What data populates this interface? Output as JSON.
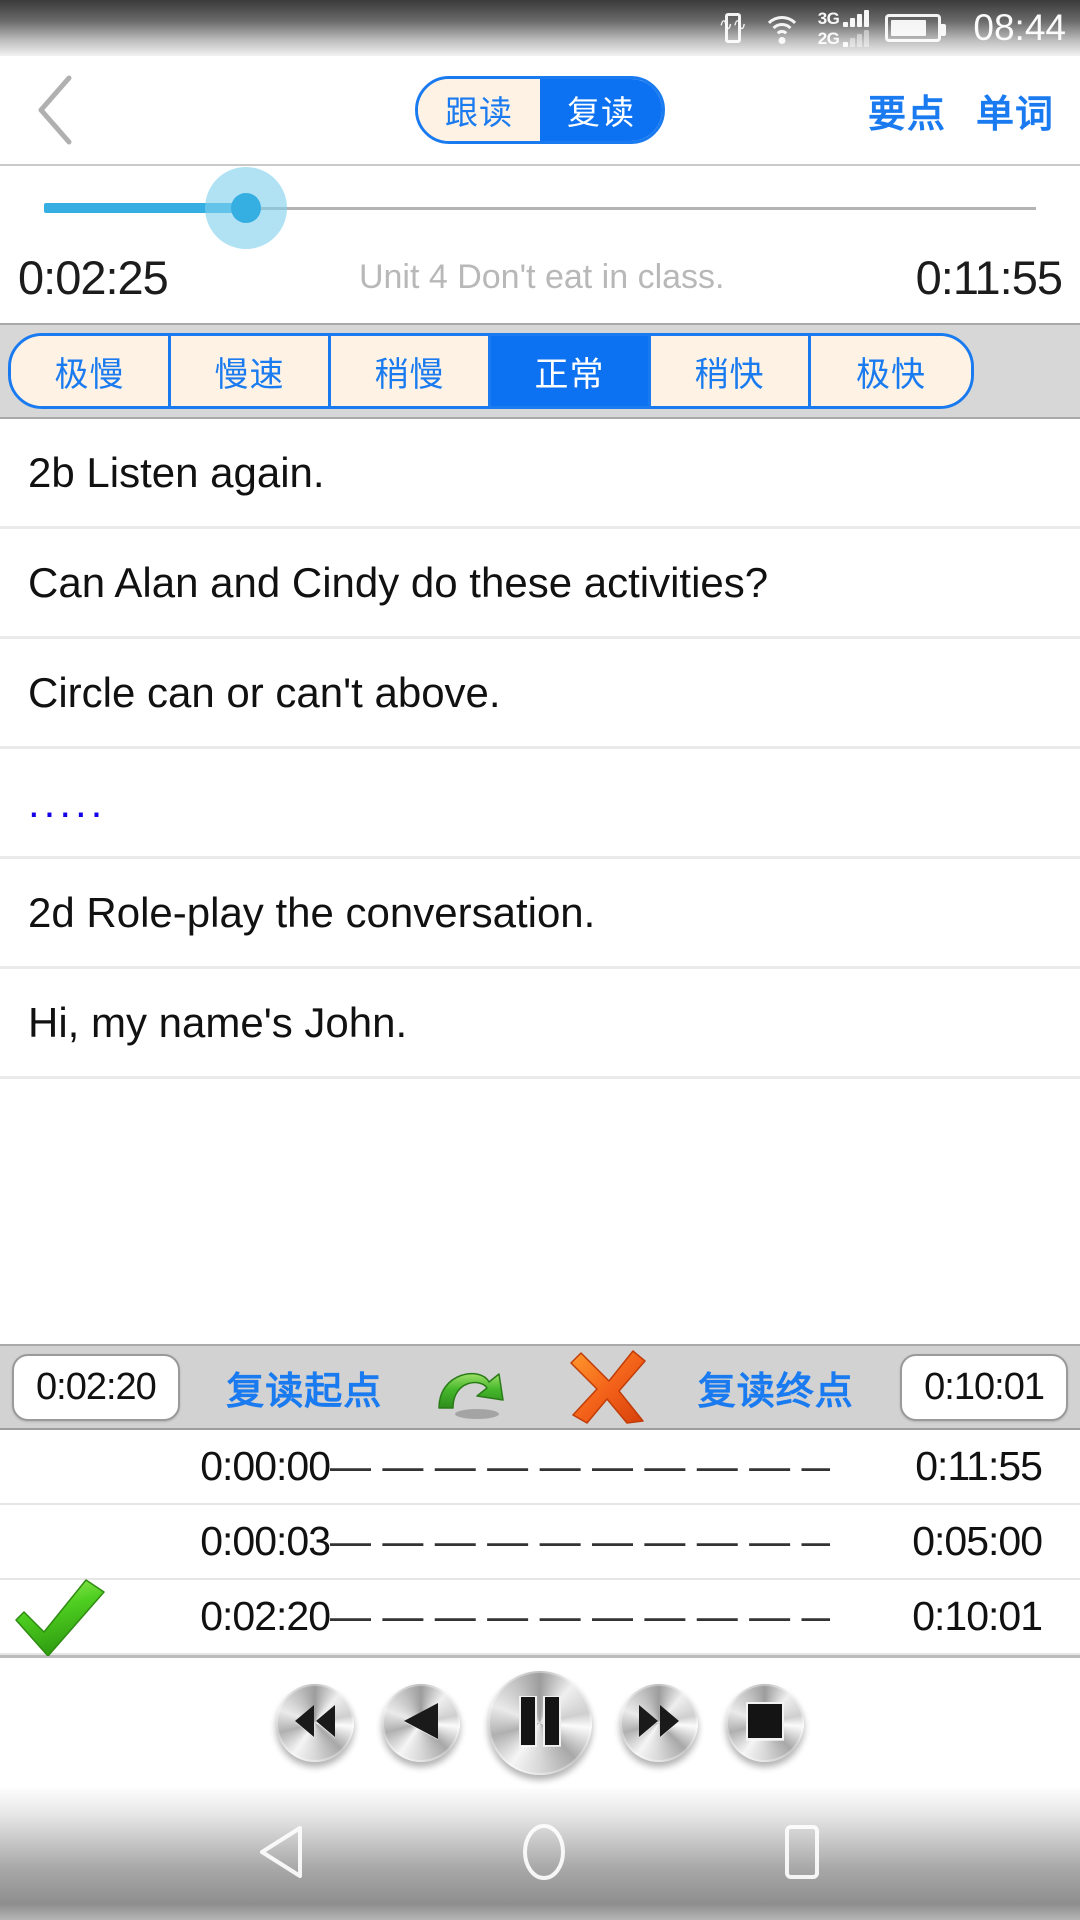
{
  "statusbar": {
    "time": "08:44",
    "icons": [
      "vibrate-icon",
      "wifi-icon",
      "signal-3g-icon",
      "signal-2g-icon",
      "battery-icon"
    ],
    "network_labels": [
      "3G",
      "2G"
    ],
    "battery_level_percent": 70
  },
  "navbar": {
    "back_icon": "chevron-left-icon",
    "segments": [
      {
        "label": "跟读",
        "active": false
      },
      {
        "label": "复读",
        "active": true
      }
    ],
    "links": [
      {
        "label": "要点"
      },
      {
        "label": "单词"
      }
    ],
    "accent_color": "#1a7bf0",
    "active_bg": "#0d72f2",
    "inactive_bg": "#fdf2e3"
  },
  "player_progress": {
    "current_time": "0:02:25",
    "total_time": "0:11:55",
    "track_title": "Unit 4 Don't eat in class.",
    "progress_percent": 20.4,
    "fill_color": "#35aee2",
    "halo_color": "#7fd0ee",
    "rail_color": "#b3b3b3"
  },
  "speed_selector": {
    "options": [
      {
        "label": "极慢",
        "active": false
      },
      {
        "label": "慢速",
        "active": false
      },
      {
        "label": "稍慢",
        "active": false
      },
      {
        "label": "正常",
        "active": true
      },
      {
        "label": "稍快",
        "active": false
      },
      {
        "label": "极快",
        "active": false
      }
    ],
    "bar_bg": "#d7d7d7"
  },
  "transcript": {
    "lines": [
      {
        "text": "2b Listen again.",
        "style": "normal"
      },
      {
        "text": "Can Alan and Cindy do these activities?",
        "style": "normal"
      },
      {
        "text": "Circle can or can't above.",
        "style": "normal"
      },
      {
        "text": ".....",
        "style": "dots"
      },
      {
        "text": "2d Role-play the conversation.",
        "style": "normal"
      },
      {
        "text": "Hi, my name's John.",
        "style": "normal"
      }
    ]
  },
  "repeat_bar": {
    "start_time": "0:02:20",
    "start_label": "复读起点",
    "loop_icon": "green-loop-arrow-icon",
    "cancel_icon": "orange-x-icon",
    "end_label": "复读终点",
    "end_time": "0:10:01",
    "bar_bg": "#d2d2d2"
  },
  "segment_list": {
    "dash_separator": "— — — — — — — — — — — —",
    "rows": [
      {
        "checked": false,
        "start": "0:00:00",
        "end": "0:11:55"
      },
      {
        "checked": false,
        "start": "0:00:03",
        "end": "0:05:00"
      },
      {
        "checked": true,
        "start": "0:02:20",
        "end": "0:10:01"
      }
    ],
    "check_icon": "green-checkmark-icon"
  },
  "playback_controls": {
    "buttons": [
      {
        "name": "rewind-button",
        "icon": "rewind-icon",
        "size": "small"
      },
      {
        "name": "previous-button",
        "icon": "previous-triangle-icon",
        "size": "small"
      },
      {
        "name": "pause-button",
        "icon": "pause-icon",
        "size": "large"
      },
      {
        "name": "fast-forward-button",
        "icon": "fast-forward-icon",
        "size": "small"
      },
      {
        "name": "stop-button",
        "icon": "stop-square-icon",
        "size": "small"
      }
    ]
  },
  "android_nav": {
    "buttons": [
      {
        "name": "android-back-button",
        "icon": "triangle-left-icon"
      },
      {
        "name": "android-home-button",
        "icon": "circle-icon"
      },
      {
        "name": "android-recents-button",
        "icon": "square-icon"
      }
    ]
  }
}
